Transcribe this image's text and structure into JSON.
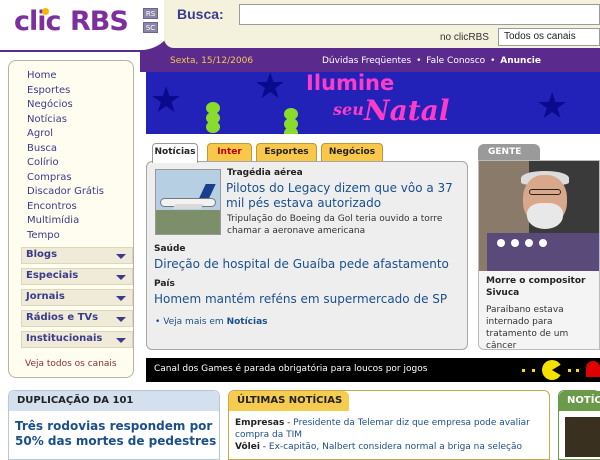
{
  "header": {
    "logo_left": "clic",
    "logo_right": "RBS",
    "state_buttons": [
      "RS",
      "SC"
    ],
    "search_label": "Busca:",
    "search_value": "",
    "scope_label": "no clicRBS",
    "scope_selected": "Todos os canais"
  },
  "infobar": {
    "date": "Sexta, 15/12/2006",
    "links": [
      "Dúvidas Freqüentes",
      "Fale Conosco",
      "Anuncie"
    ],
    "separator": "•"
  },
  "sidebar": {
    "links": [
      "Home",
      "Esportes",
      "Negócios",
      "Notícias",
      "Agrol",
      "Busca",
      "Colírio",
      "Compras",
      "Discador Grátis",
      "Encontros",
      "Multimídia",
      "Tempo"
    ],
    "categories": [
      "Blogs",
      "Especiais",
      "Jornais",
      "Rádios e TVs",
      "Institucionais"
    ],
    "see_all": "Veja todos os canais"
  },
  "banner": {
    "line1": "Ilumine",
    "line2a": "seu",
    "line2b": "Natal",
    "colors": {
      "background": "#2222b8",
      "text": "#ff3cc8"
    }
  },
  "news": {
    "tabs": [
      "Notícias",
      "Inter",
      "Esportes",
      "Negócios"
    ],
    "lead": {
      "kicker": "Tragédia aérea",
      "headline": "Pilotos do Legacy dizem que vôo a 37 mil pés estava autorizado",
      "summary": "Tripulação do Boeing da Gol teria ouvido a torre chamar a aeronave americana"
    },
    "items": [
      {
        "kicker": "Saúde",
        "headline": "Direção de hospital de Guaíba pede afastamento"
      },
      {
        "kicker": "País",
        "headline": "Homem mantém reféns em supermercado de SP"
      }
    ],
    "see_more_prefix": "Veja mais em",
    "see_more_target": "Notícias",
    "bullet": "•"
  },
  "gente": {
    "tab": "GENTE",
    "title": "Morre o compositor Sivuca",
    "text": "Paraibano estava internado para tratamento de um câncer"
  },
  "games": {
    "text": "Canal dos Games é parada obrigatória para loucos por jogos"
  },
  "bottom": {
    "duplicacao": {
      "title": "DUPLICAÇÃO DA 101",
      "headline": "Três rodovias respondem por 50% das mortes de pedestres"
    },
    "ultimas": {
      "title": "ÚLTIMAS NOTÍCIAS",
      "items": [
        {
          "tag": "Empresas",
          "text": "Presidente da Telemar diz que empresa pode avaliar compra da TIM"
        },
        {
          "tag": "Vôlei",
          "text": "Ex-capitão, Nalbert considera normal a briga na seleção"
        }
      ],
      "separator": " - "
    },
    "noticias": {
      "title": "NOTÍC"
    }
  },
  "colors": {
    "header_purple": "#5a2a8c",
    "link_blue": "#1b4f8a",
    "tab_yellow": "#f9c74a"
  }
}
